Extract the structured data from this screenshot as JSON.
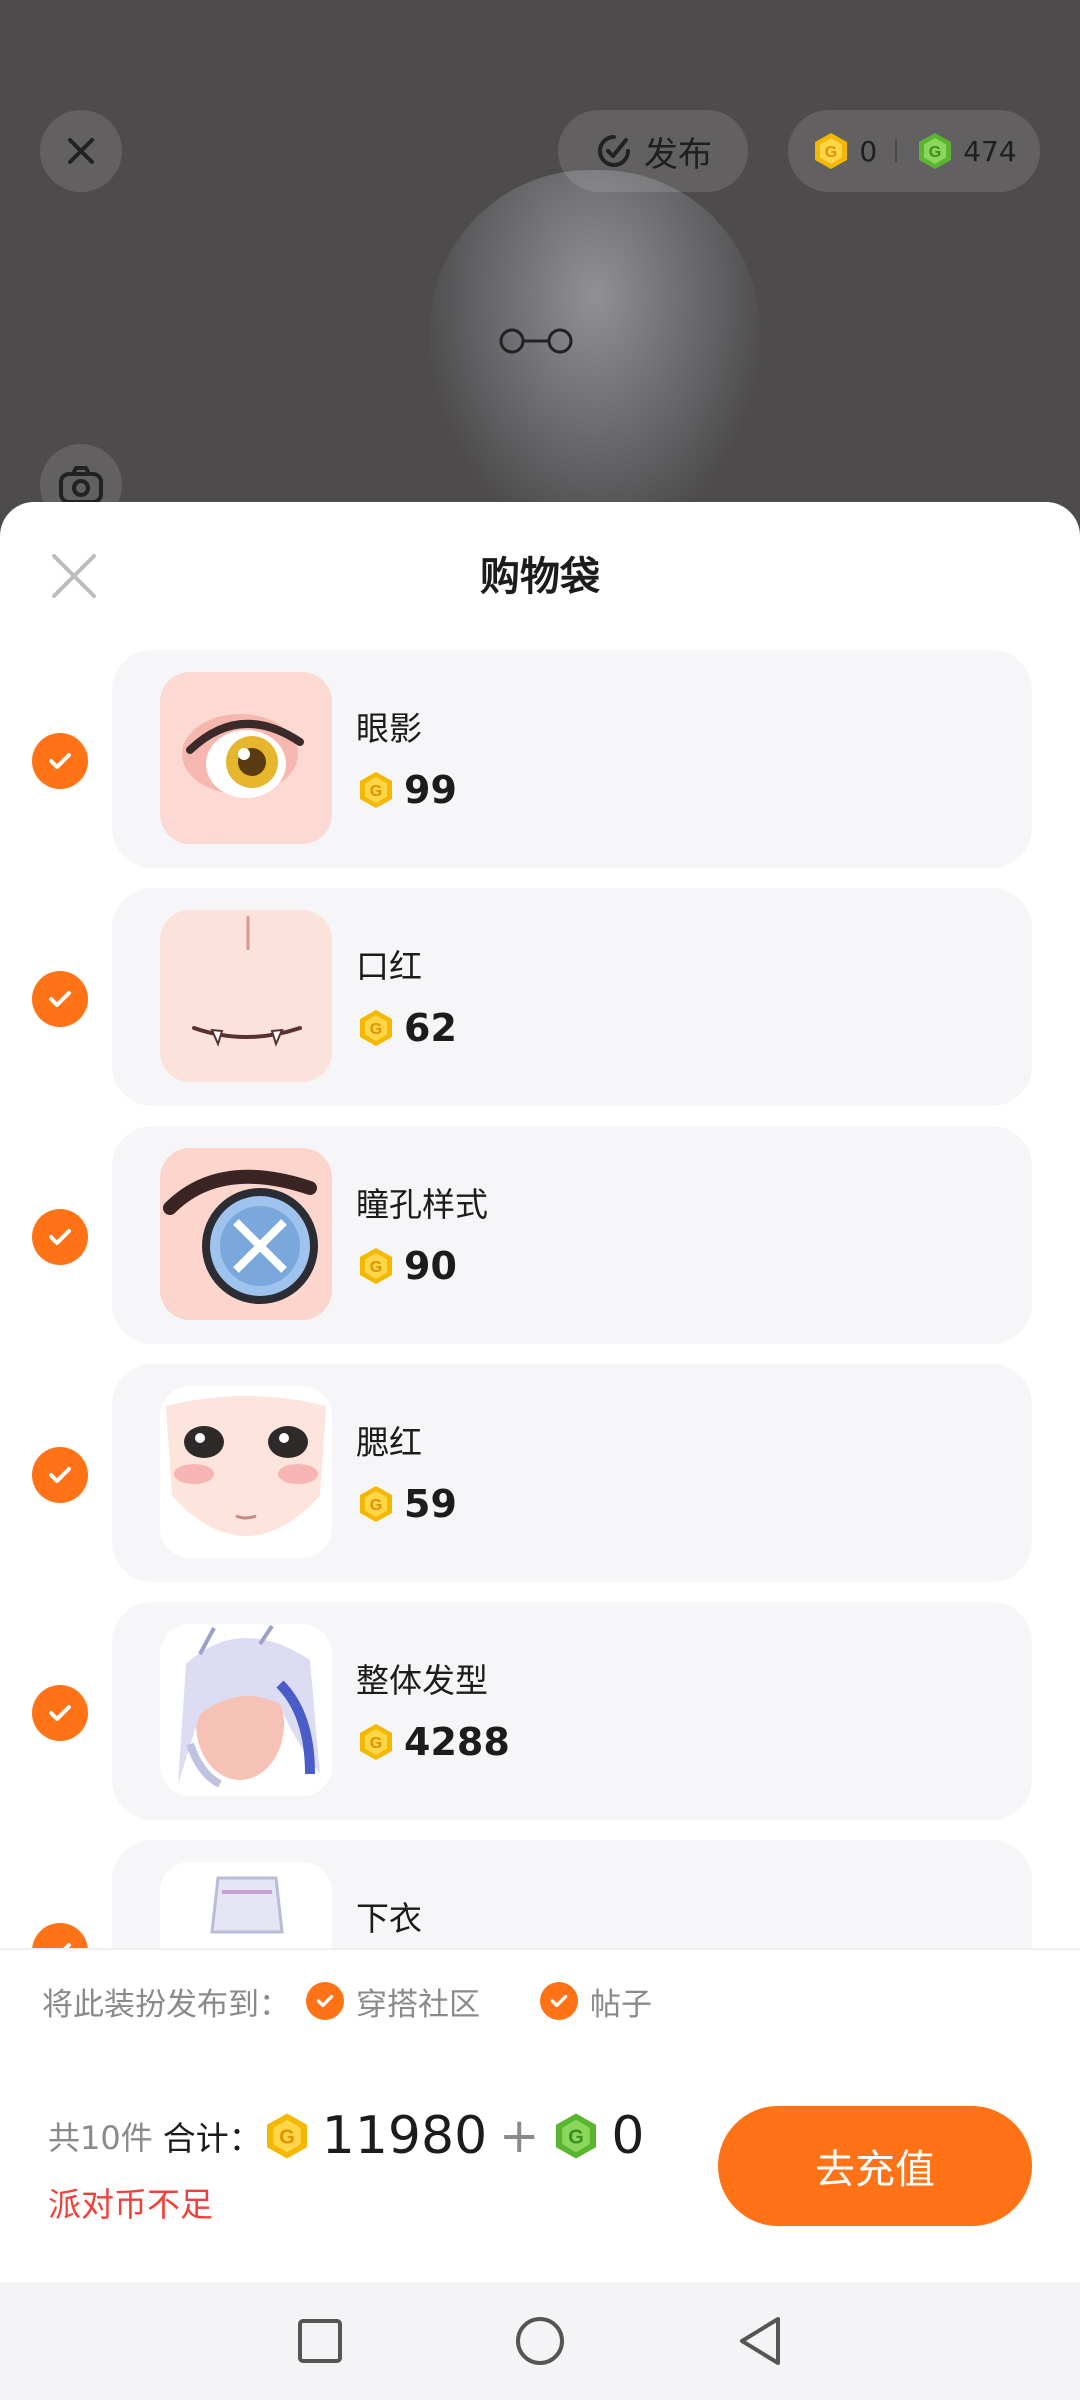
{
  "top_bar": {
    "publish_label": "发布",
    "gold_balance": "0",
    "green_balance": "474"
  },
  "sheet": {
    "title": "购物袋"
  },
  "items": [
    {
      "name": "眼影",
      "price": "99",
      "selected": true
    },
    {
      "name": "口红",
      "price": "62",
      "selected": true
    },
    {
      "name": "瞳孔样式",
      "price": "90",
      "selected": true
    },
    {
      "name": "腮红",
      "price": "59",
      "selected": true
    },
    {
      "name": "整体发型",
      "price": "4288",
      "selected": true
    },
    {
      "name": "下衣",
      "price": "",
      "selected": true
    }
  ],
  "publish_to": {
    "label": "将此装扮发布到：",
    "options": [
      {
        "label": "穿搭社区",
        "checked": true
      },
      {
        "label": "帖子",
        "checked": true
      }
    ]
  },
  "footer": {
    "count_text": "共10件",
    "sum_label": "合计：",
    "gold_total": "11980",
    "plus": "+",
    "green_total": "0",
    "warning": "派对币不足",
    "recharge_label": "去充值"
  },
  "colors": {
    "accent": "#ff7216",
    "warning": "#f2403a",
    "gold_coin": "#f5b800",
    "green_coin": "#5cb531"
  },
  "icons": [
    "close-icon",
    "publish-icon",
    "gold-coin-icon",
    "green-coin-icon",
    "camera-icon",
    "checkmark-icon",
    "nav-square-icon",
    "nav-circle-icon",
    "nav-back-icon"
  ]
}
